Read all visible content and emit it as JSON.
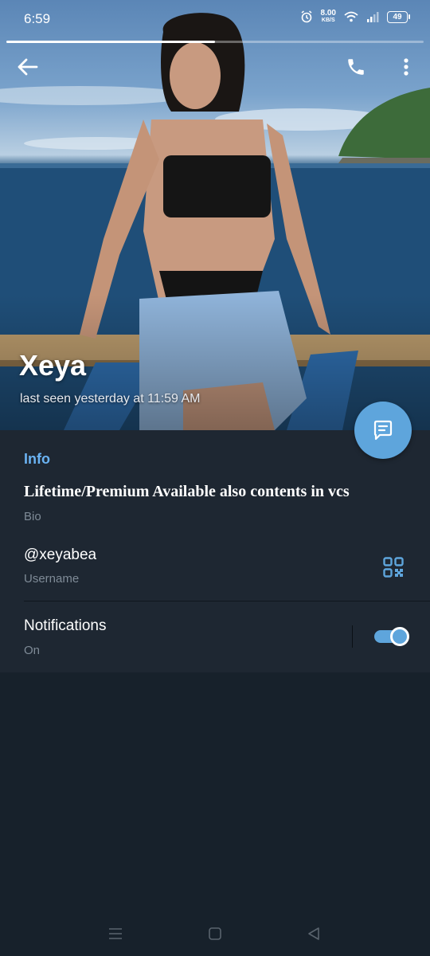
{
  "status_bar": {
    "time": "6:59",
    "net_speed_value": "8.00",
    "net_speed_unit": "KB/S",
    "battery": "49"
  },
  "header": {
    "progress_fraction": 0.5,
    "profile_name": "Xeya",
    "last_seen": "last seen yesterday at 11:59 AM",
    "icons": {
      "back": "arrow-left-icon",
      "call": "phone-icon",
      "menu": "more-vertical-icon",
      "fab": "message-icon"
    }
  },
  "info": {
    "heading": "Info",
    "bio": "Lifetime/Premium Available also contents in vcs",
    "bio_caption": "Bio",
    "username": "@xeyabea",
    "username_caption": "Username",
    "notifications_label": "Notifications",
    "notifications_state": "On",
    "notifications_enabled": true
  },
  "colors": {
    "accent": "#6ab3f3",
    "fab": "#5ea5dc",
    "card": "#1e2732",
    "background": "#17212b"
  },
  "nav": {
    "icons": [
      "menu-lines-icon",
      "home-square-icon",
      "back-triangle-icon"
    ]
  }
}
